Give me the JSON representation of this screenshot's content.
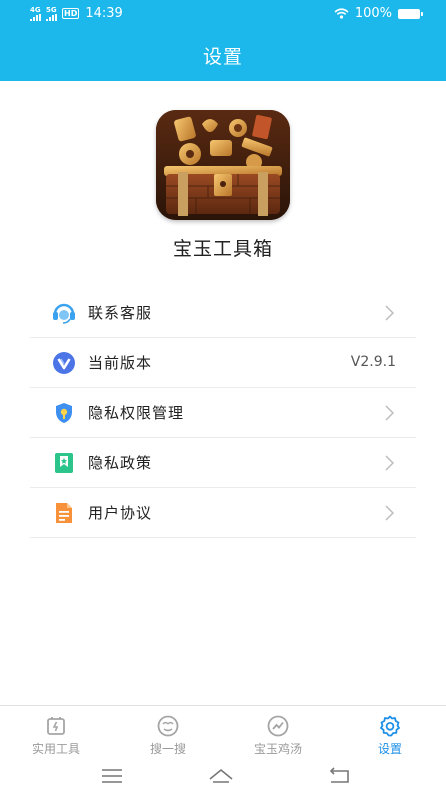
{
  "status_bar": {
    "network_top": "4G",
    "network_bottom": "5G",
    "hd": "HD",
    "time": "14:39",
    "battery": "100%"
  },
  "header": {
    "title": "设置",
    "background": "#1cb8ec"
  },
  "app": {
    "name": "宝玉工具箱",
    "icon": "treasure-chest-icon"
  },
  "menu": [
    {
      "label": "联系客服",
      "icon": "customer-service-icon",
      "chevron": true
    },
    {
      "label": "当前版本",
      "icon": "version-icon",
      "value": "V2.9.1"
    },
    {
      "label": "隐私权限管理",
      "icon": "privacy-shield-icon",
      "chevron": true
    },
    {
      "label": "隐私政策",
      "icon": "policy-bookmark-icon",
      "chevron": true
    },
    {
      "label": "用户协议",
      "icon": "agreement-document-icon",
      "chevron": true
    }
  ],
  "tabs": [
    {
      "label": "实用工具",
      "icon": "tools-icon",
      "active": false
    },
    {
      "label": "搜一搜",
      "icon": "search-face-icon",
      "active": false
    },
    {
      "label": "宝玉鸡汤",
      "icon": "chicken-soup-icon",
      "active": false
    },
    {
      "label": "设置",
      "icon": "settings-gear-icon",
      "active": true
    }
  ],
  "colors": {
    "accent": "#1cb8ec",
    "tab_active": "#1c8fe8",
    "tab_inactive": "#9a9a9a"
  }
}
